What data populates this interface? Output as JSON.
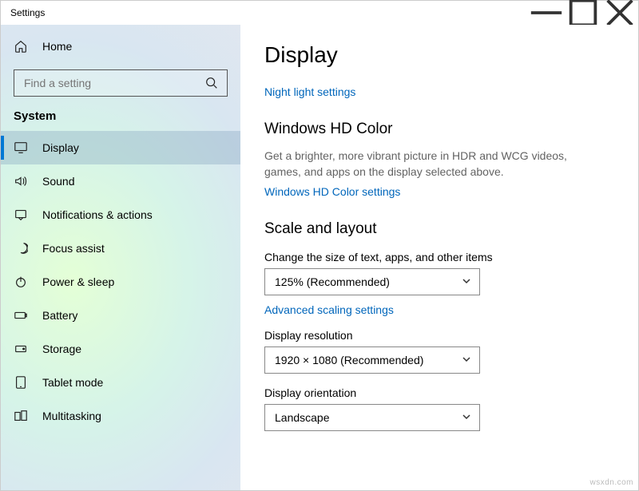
{
  "window": {
    "title": "Settings"
  },
  "sidebar": {
    "home": "Home",
    "search_placeholder": "Find a setting",
    "category": "System",
    "items": [
      {
        "id": "display",
        "label": "Display",
        "selected": true
      },
      {
        "id": "sound",
        "label": "Sound",
        "selected": false
      },
      {
        "id": "notifications",
        "label": "Notifications & actions",
        "selected": false
      },
      {
        "id": "focus",
        "label": "Focus assist",
        "selected": false
      },
      {
        "id": "power",
        "label": "Power & sleep",
        "selected": false
      },
      {
        "id": "battery",
        "label": "Battery",
        "selected": false
      },
      {
        "id": "storage",
        "label": "Storage",
        "selected": false
      },
      {
        "id": "tablet",
        "label": "Tablet mode",
        "selected": false
      },
      {
        "id": "multitasking",
        "label": "Multitasking",
        "selected": false
      }
    ]
  },
  "main": {
    "title": "Display",
    "night_light_link": "Night light settings",
    "hd_color": {
      "heading": "Windows HD Color",
      "desc": "Get a brighter, more vibrant picture in HDR and WCG videos, games, and apps on the display selected above.",
      "link": "Windows HD Color settings"
    },
    "scale": {
      "heading": "Scale and layout",
      "size_label": "Change the size of text, apps, and other items",
      "size_value": "125% (Recommended)",
      "advanced_link": "Advanced scaling settings",
      "resolution_label": "Display resolution",
      "resolution_value": "1920 × 1080 (Recommended)",
      "orientation_label": "Display orientation",
      "orientation_value": "Landscape"
    }
  },
  "watermark": "wsxdn.com"
}
